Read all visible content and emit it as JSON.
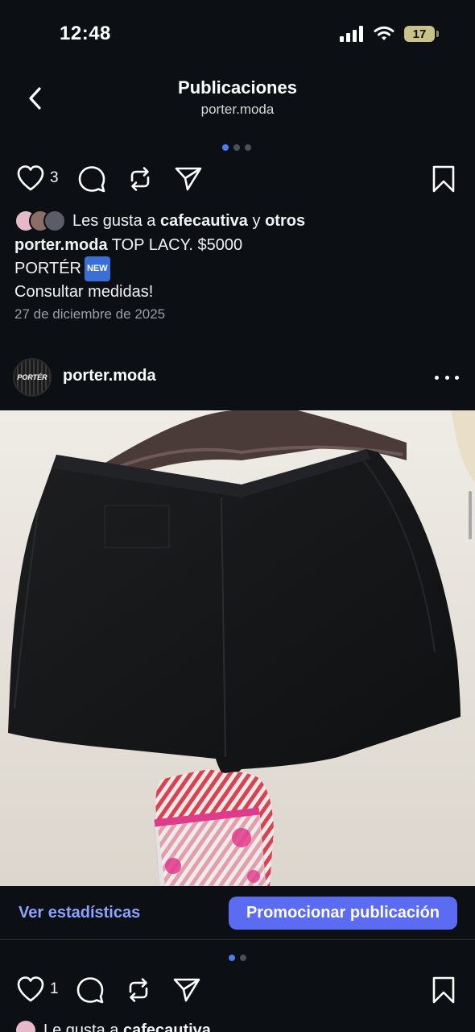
{
  "status_bar": {
    "time": "12:48",
    "battery": "17",
    "icons": [
      "signal-icon",
      "wifi-icon",
      "battery-icon"
    ]
  },
  "header": {
    "title": "Publicaciones",
    "subtitle": "porter.moda",
    "back_icon": "chevron-left-icon"
  },
  "previous_post": {
    "carousel": {
      "count": 3,
      "active": 1
    },
    "like_count": "3",
    "likes_prefix": "Les gusta a ",
    "likes_user": "cafecautiva",
    "likes_connector": " y ",
    "likes_others": "otros",
    "caption_user": "porter.moda",
    "caption_line1": " TOP LACY. $5000",
    "caption_line2": "PORTÉR",
    "new_badge": "NEW",
    "caption_line3": "Consultar medidas!",
    "date": "27 de diciembre de 2025"
  },
  "post": {
    "avatar_text": "PORTÉR",
    "username": "porter.moda",
    "image": "black-shorts-on-hanger-photo",
    "insights_label": "Ver estadísticas",
    "promote_label": "Promocionar publicación",
    "carousel": {
      "count": 2,
      "active": 0
    },
    "like_count": "1",
    "likes_prefix": "Le gusta a ",
    "likes_user": "cafecautiva"
  },
  "colors": {
    "background": "#0c0f14",
    "accent": "#5b6cf2",
    "link": "#8ea2ff",
    "active_dot": "#4f7cf0"
  }
}
